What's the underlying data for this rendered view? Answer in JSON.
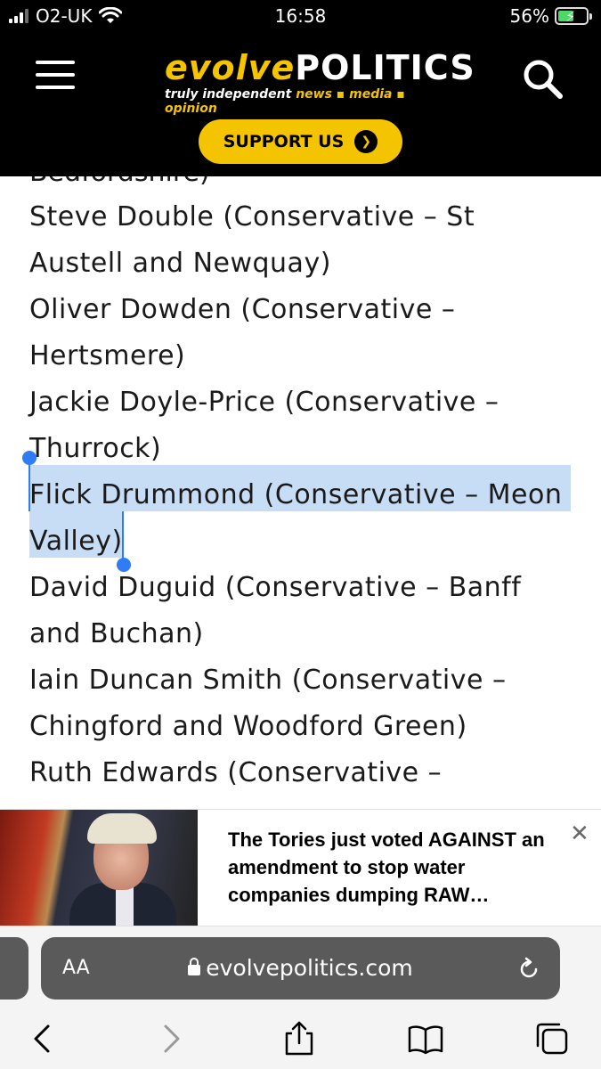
{
  "status_bar": {
    "carrier": "O2-UK",
    "time": "16:58",
    "battery": "56%",
    "battery_level": 0.56
  },
  "header": {
    "logo_left": "evolve",
    "logo_right": "POLITICS",
    "tagline_left": "truly independent",
    "tagline_right": "news ▪ media ▪ opinion",
    "support_label": "SUPPORT US",
    "accent_color": "#f5c400"
  },
  "article": {
    "cut_text": "Bedfordshire)",
    "lines": [
      "Steve Double (Conservative – St",
      "Austell and Newquay)",
      "Oliver Dowden (Conservative –",
      "Hertsmere)",
      "Jackie Doyle-Price (Conservative –",
      "Thurrock)",
      "Flick Drummond (Conservative – Meon",
      "Valley)",
      "David Duguid (Conservative – Banff",
      "and Buchan)",
      "Iain Duncan Smith (Conservative –",
      "Chingford and Woodford Green)",
      "Ruth Edwards (Conservative –"
    ],
    "selection_color": "#c7dcf5"
  },
  "ad": {
    "title": "The Tories just voted AGAINST an amendment to stop water companies dumping RAW…",
    "close": "✕"
  },
  "browser": {
    "aa_label": "AA",
    "url": "evolvepolitics.com"
  }
}
